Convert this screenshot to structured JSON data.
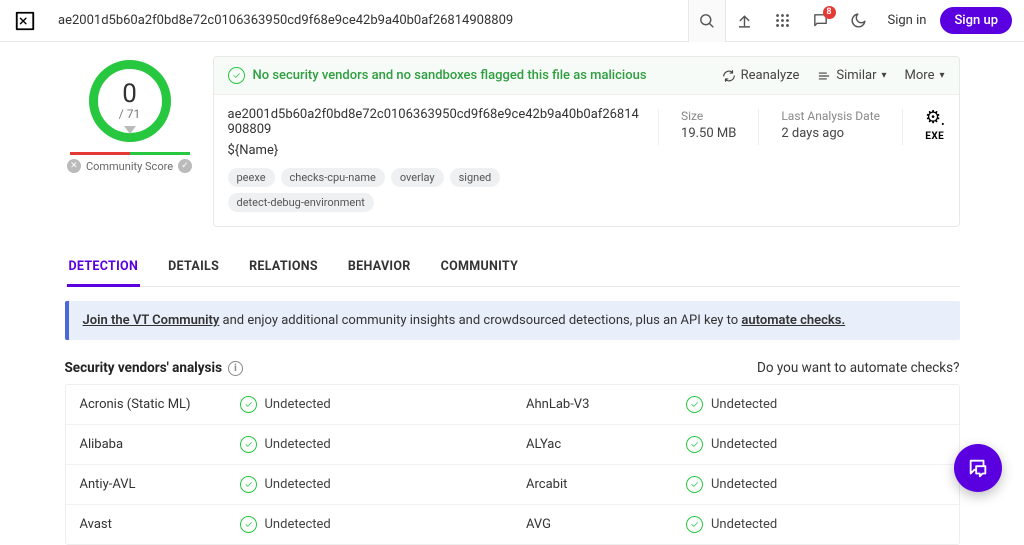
{
  "topbar": {
    "search_value": "ae2001d5b60a2f0bd8e72c0106363950cd9f68e9ce42b9a40b0af26814908809",
    "notification_count": "8",
    "signin": "Sign in",
    "signup": "Sign up"
  },
  "score": {
    "detections": "0",
    "total": "/ 71",
    "community_label": "Community Score"
  },
  "status": {
    "message": "No security vendors and no sandboxes flagged this file as malicious",
    "reanalyze": "Reanalyze",
    "similar": "Similar",
    "more": "More"
  },
  "file": {
    "hash": "ae2001d5b60a2f0bd8e72c0106363950cd9f68e9ce42b9a40b0af26814908809",
    "name": "${Name}",
    "tags": [
      "peexe",
      "checks-cpu-name",
      "overlay",
      "signed",
      "detect-debug-environment"
    ],
    "size_label": "Size",
    "size_value": "19.50 MB",
    "date_label": "Last Analysis Date",
    "date_value": "2 days ago",
    "type": "EXE"
  },
  "tabs": [
    "DETECTION",
    "DETAILS",
    "RELATIONS",
    "BEHAVIOR",
    "COMMUNITY"
  ],
  "banner": {
    "link1": "Join the VT Community",
    "middle": " and enjoy additional community insights and crowdsourced detections, plus an API key to ",
    "link2": "automate checks."
  },
  "vendors": {
    "heading": "Security vendors' analysis",
    "automate": "Do you want to automate checks?",
    "rows": [
      {
        "l_name": "Acronis (Static ML)",
        "l_status": "Undetected",
        "r_name": "AhnLab-V3",
        "r_status": "Undetected"
      },
      {
        "l_name": "Alibaba",
        "l_status": "Undetected",
        "r_name": "ALYac",
        "r_status": "Undetected"
      },
      {
        "l_name": "Antiy-AVL",
        "l_status": "Undetected",
        "r_name": "Arcabit",
        "r_status": "Undetected"
      },
      {
        "l_name": "Avast",
        "l_status": "Undetected",
        "r_name": "AVG",
        "r_status": "Undetected"
      }
    ]
  }
}
